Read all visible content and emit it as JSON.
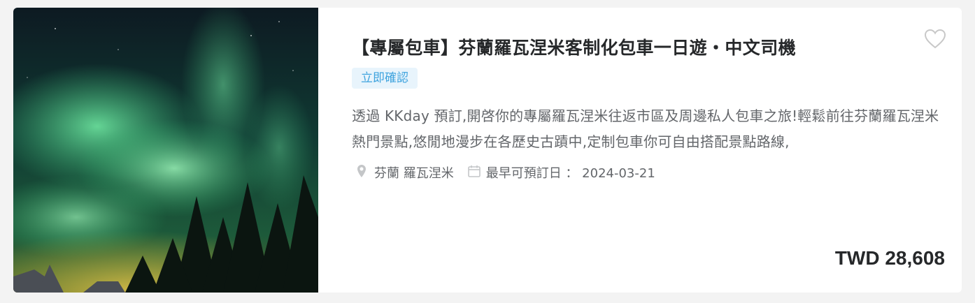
{
  "product": {
    "title": "【專屬包車】芬蘭羅瓦涅米客制化包車一日遊・中文司機",
    "badge": "立即確認",
    "description": "透過 KKday 預訂,開啓你的專屬羅瓦涅米往返市區及周邊私人包車之旅!輕鬆前往芬蘭羅瓦涅米熱門景點,悠閒地漫步在各歷史古蹟中,定制包車你可自由搭配景點路線,",
    "location": "芬蘭 羅瓦涅米",
    "earliest_date_label": "最早可預訂日 ： 2024-03-21",
    "price": "TWD 28,608",
    "image_alt": "aurora-borealis-photo"
  },
  "icons": {
    "favorite": "heart-outline-icon",
    "location": "map-pin-icon",
    "calendar": "calendar-icon"
  },
  "colors": {
    "title": "#26282a",
    "badge_text": "#3ea3de",
    "badge_bg": "#e8f4fc",
    "body_text": "#63666a"
  }
}
